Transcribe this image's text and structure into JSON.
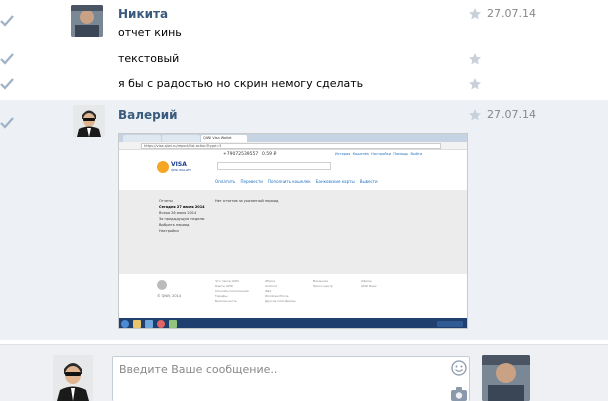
{
  "messages": [
    {
      "author": "Никита",
      "date": "27.07.14",
      "text": "отчет кинь"
    },
    {
      "text": "текстовый"
    },
    {
      "text": "я бы с радостью но скрин немогу сделать"
    },
    {
      "author": "Валерий",
      "date": "27.07.14"
    }
  ],
  "screenshot": {
    "url_tab": "QIWI Visa Wallet",
    "address": "https://visa.qiwi.ru/report/list.action?type=3",
    "phone": "+79072539557",
    "balance": "0.59 ₽",
    "top_links": [
      "История",
      "Кошелёк",
      "Настройки",
      "Помощь",
      "Выйти"
    ],
    "logo_line1": "VISA",
    "logo_line2": "QIWI WALLET",
    "nav": [
      "Оплатить",
      "Перевести",
      "Пополнить кошелек",
      "Банковские карты",
      "Вывести"
    ],
    "side_title": "Отчеты",
    "side_items": [
      "Сегодня 27 июля 2014",
      "Вчера 26 июля 2014",
      "За предыдущую неделю",
      "Выбрать период",
      "Настройки"
    ],
    "empty_note": "Нет отчетов за указанный период",
    "footer_copy": "© QIWI, 2014",
    "footer_cols": [
      [
        "Что такое QIWI",
        "Карты QIWI",
        "Способы пополнения",
        "Тарифы",
        "Безопасность"
      ],
      [
        "iPhone",
        "Android",
        "iPad",
        "Windows Phone",
        "Другие платформы"
      ],
      [
        "Вакансии",
        "Пресс-центр"
      ],
      [
        "Офисы",
        "QIWI Банк"
      ]
    ]
  },
  "composer": {
    "placeholder": "Введите Ваше сообщение.."
  },
  "colors": {
    "name": "#3b5b7e",
    "accent_blue": "#5b9bd5",
    "qiwi_orange": "#f5a623",
    "taskbar": "#1f3f6e"
  }
}
